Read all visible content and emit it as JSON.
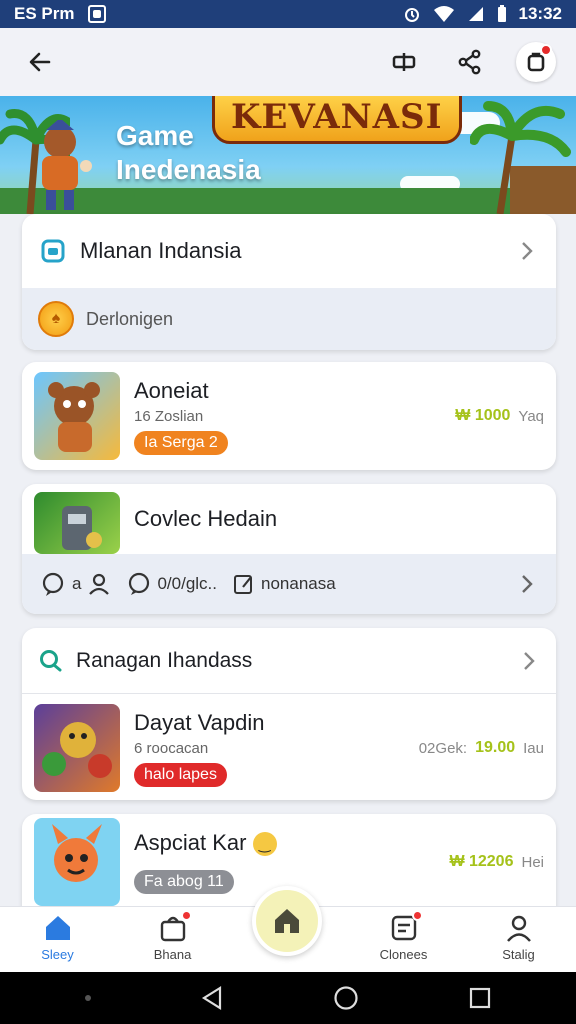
{
  "status": {
    "carrier": "ES Prm",
    "time": "13:32"
  },
  "banner": {
    "logo": "KEVANASI",
    "line1": "Game",
    "line2": "Inedenasia"
  },
  "section1": {
    "title": "Mlanan Indansia",
    "sub_label": "Derlonigen"
  },
  "game1": {
    "name": "Aoneiat",
    "sub": "16 Zoslian",
    "tag": "Ia Serga 2",
    "tag_color": "#f0831f",
    "price": "1000",
    "unit": "Yaq"
  },
  "game2": {
    "name": "Covlec Hedain"
  },
  "actions": {
    "count": "a",
    "comment": "0/0/glc..",
    "share": "nonanasa"
  },
  "section2": {
    "title": "Ranagan Ihandass"
  },
  "game3": {
    "name": "Dayat Vapdin",
    "sub": "6 roocacan",
    "tag": "halo lapes",
    "tag_color": "#e02a2a",
    "price_prefix": "02Gek:",
    "price": "19.00",
    "unit": "Iau"
  },
  "game4": {
    "name": "Aspciat Kar",
    "tag": "Fa abog 11",
    "tag_color": "#8d8f95",
    "price": "12206",
    "unit": "Hei"
  },
  "nav": {
    "tab1": "Sleey",
    "tab2": "Bhana",
    "tab4": "Clonees",
    "tab5": "Stalig"
  },
  "colors": {
    "statusbar": "#1f3f7a",
    "accent": "#2b7be0",
    "price_green": "#a5c21a"
  }
}
